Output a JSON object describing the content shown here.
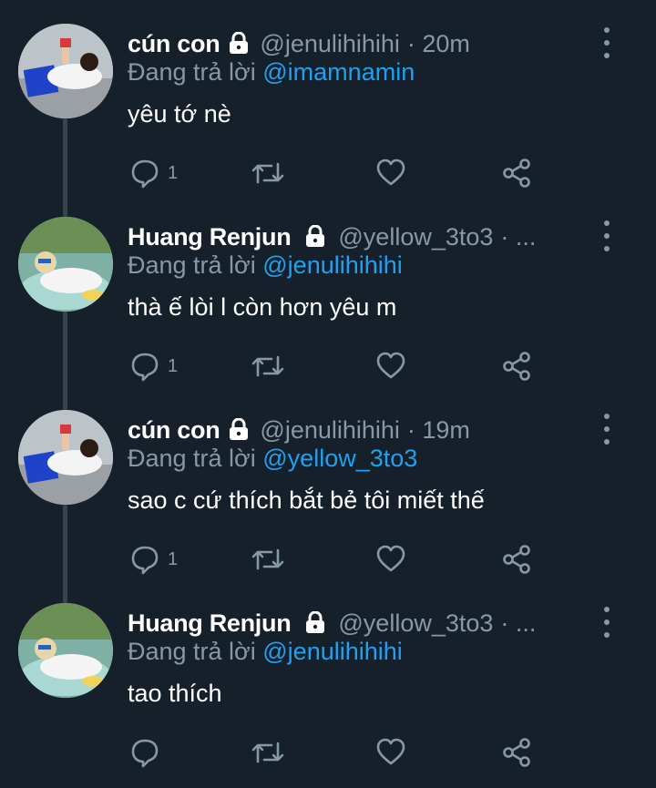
{
  "colors": {
    "background": "#15202b",
    "text": "#ffffff",
    "muted": "#8899a6",
    "accent": "#1da1f2",
    "thread_line": "#38444d"
  },
  "tweets": [
    {
      "name": "cún con",
      "handle": "@jenulihihihi",
      "time": "· 20m",
      "replying_prefix": "Đang trả lời ",
      "replying_to": "@imamnamin",
      "text": "yêu tớ nè",
      "reply_count": "1",
      "avatar_icon": "avatar-photo-icon"
    },
    {
      "name": "Huang Renjun",
      "handle": "@yellow_3to3",
      "time": "· ...",
      "replying_prefix": "Đang trả lời ",
      "replying_to": "@jenulihihihi",
      "text": "thà ế lòi l còn hơn yêu m",
      "reply_count": "1",
      "avatar_icon": "avatar-photo-icon"
    },
    {
      "name": "cún con",
      "handle": "@jenulihihihi",
      "time": "· 19m",
      "replying_prefix": "Đang trả lời ",
      "replying_to": "@yellow_3to3",
      "text": "sao c cứ thích bắt bẻ tôi miết thế",
      "reply_count": "1",
      "avatar_icon": "avatar-photo-icon"
    },
    {
      "name": "Huang Renjun",
      "handle": "@yellow_3to3",
      "time": "· ...",
      "replying_prefix": "Đang trả lời ",
      "replying_to": "@jenulihihihi",
      "text": "tao thích",
      "reply_count": "",
      "avatar_icon": "avatar-photo-icon"
    }
  ],
  "icons": [
    "lock-icon",
    "more-icon",
    "reply-icon",
    "retweet-icon",
    "like-icon",
    "share-icon"
  ]
}
